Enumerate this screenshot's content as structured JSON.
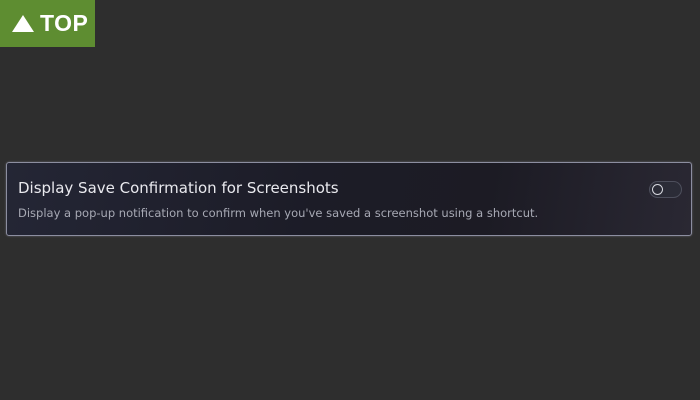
{
  "badge": {
    "label": "TOP",
    "icon": "triangle-up-icon",
    "color": "#5e8d31"
  },
  "setting": {
    "title": "Display Save Confirmation for Screenshots",
    "description": "Display a pop-up notification to confirm when you've saved a screenshot using a shortcut.",
    "toggle_state": "off"
  },
  "colors": {
    "background": "#2e2e2e",
    "row_background": "#1c1c27",
    "row_border": "#8c8ea0",
    "title_text": "#e9e9ee",
    "description_text": "#a7a9b4"
  }
}
